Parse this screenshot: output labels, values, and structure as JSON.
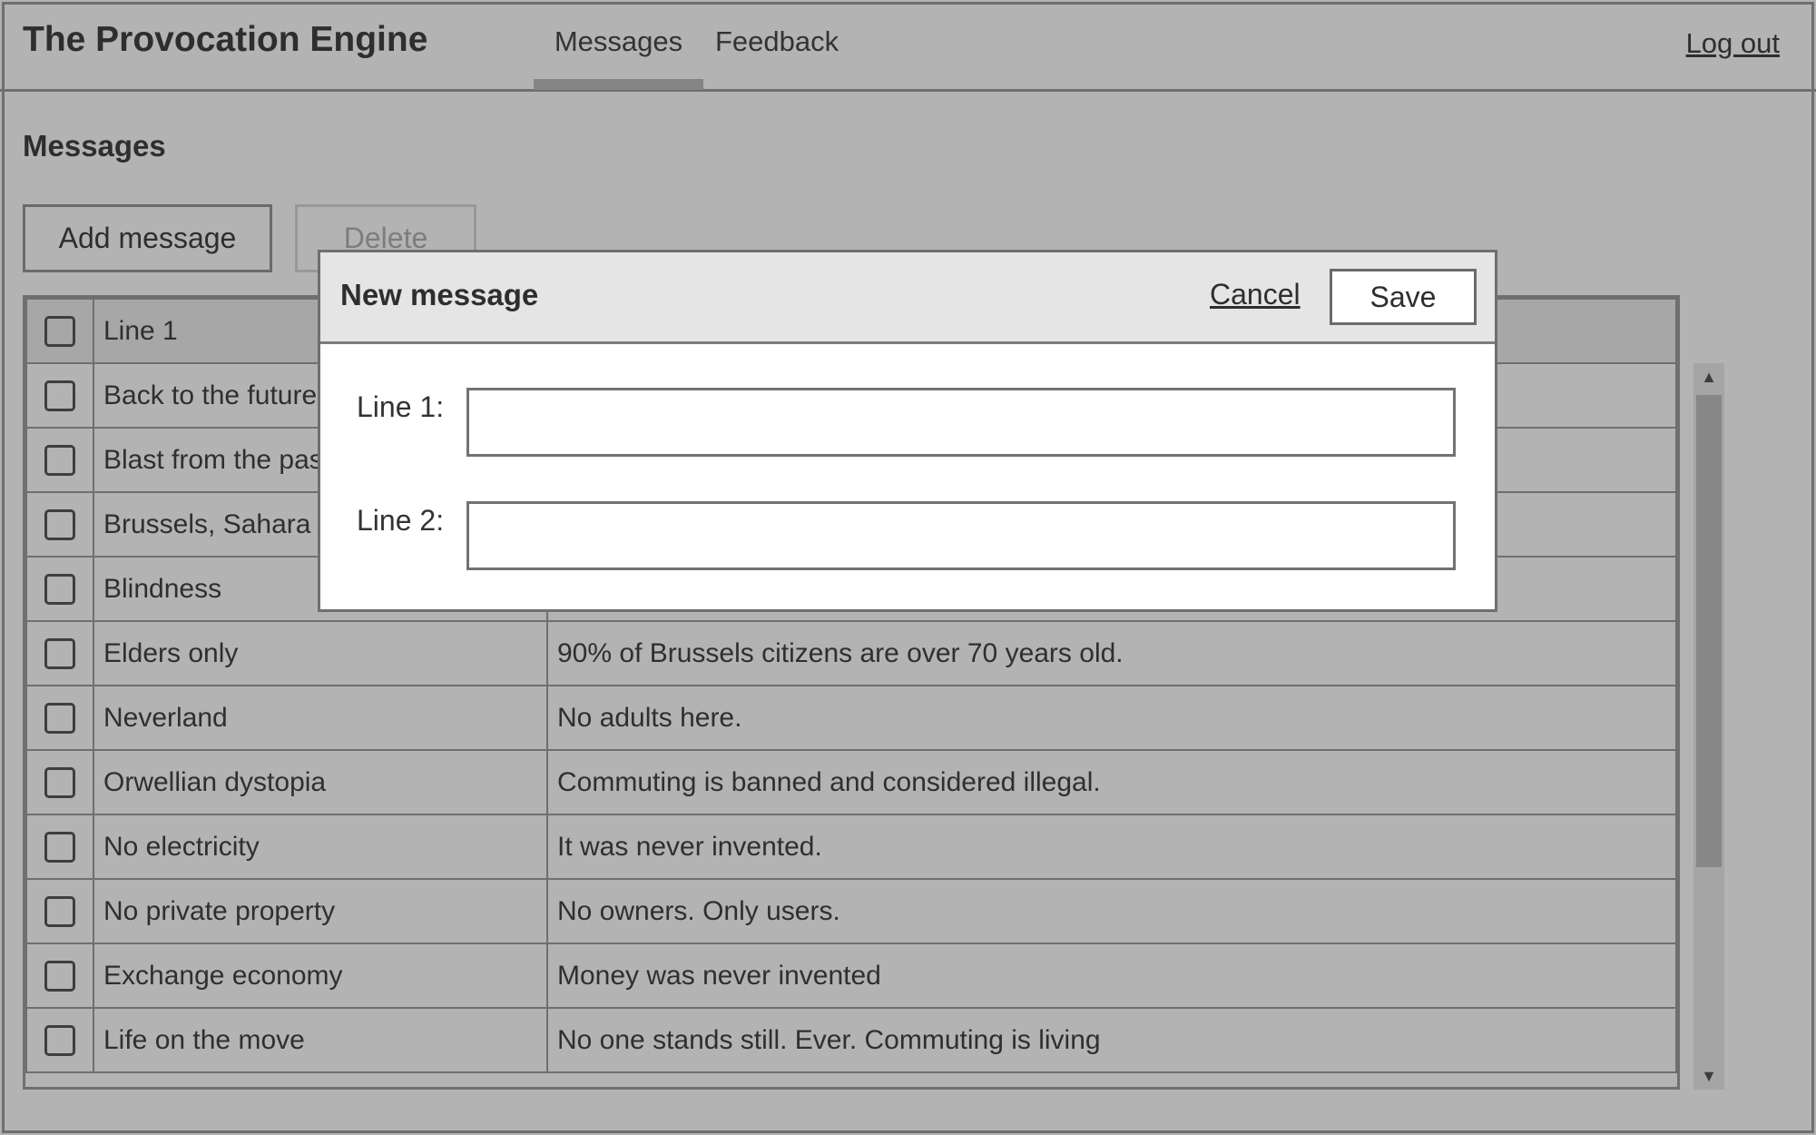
{
  "header": {
    "app_title": "The Provocation Engine",
    "nav": [
      {
        "label": "Messages",
        "active": true
      },
      {
        "label": "Feedback",
        "active": false
      }
    ],
    "logout_label": "Log out"
  },
  "page": {
    "title": "Messages",
    "add_label": "Add message",
    "delete_label": "Delete"
  },
  "table": {
    "headers": [
      "Line 1",
      "Line 2"
    ],
    "rows": [
      {
        "line1": "Back to the future",
        "line2": ""
      },
      {
        "line1": "Blast from the past",
        "line2": ""
      },
      {
        "line1": "Brussels, Sahara c",
        "line2": ""
      },
      {
        "line1": "Blindness",
        "line2": ""
      },
      {
        "line1": "Elders only",
        "line2": "90% of Brussels citizens are over 70 years old."
      },
      {
        "line1": "Neverland",
        "line2": "No adults here."
      },
      {
        "line1": "Orwellian dystopia",
        "line2": "Commuting is banned and considered illegal."
      },
      {
        "line1": "No electricity",
        "line2": "It was never invented."
      },
      {
        "line1": "No private property",
        "line2": "No owners. Only users."
      },
      {
        "line1": "Exchange economy",
        "line2": "Money was never invented"
      },
      {
        "line1": "Life on the move",
        "line2": "No one stands still. Ever. Commuting is living"
      }
    ]
  },
  "modal": {
    "title": "New message",
    "cancel_label": "Cancel",
    "save_label": "Save",
    "line1_label": "Line 1:",
    "line1_value": "",
    "line2_label": "Line 2:",
    "line2_value": ""
  },
  "colors": {
    "background": "#b3b3b3",
    "modal_header": "#e5e5e5",
    "border": "#6f6f6f"
  }
}
